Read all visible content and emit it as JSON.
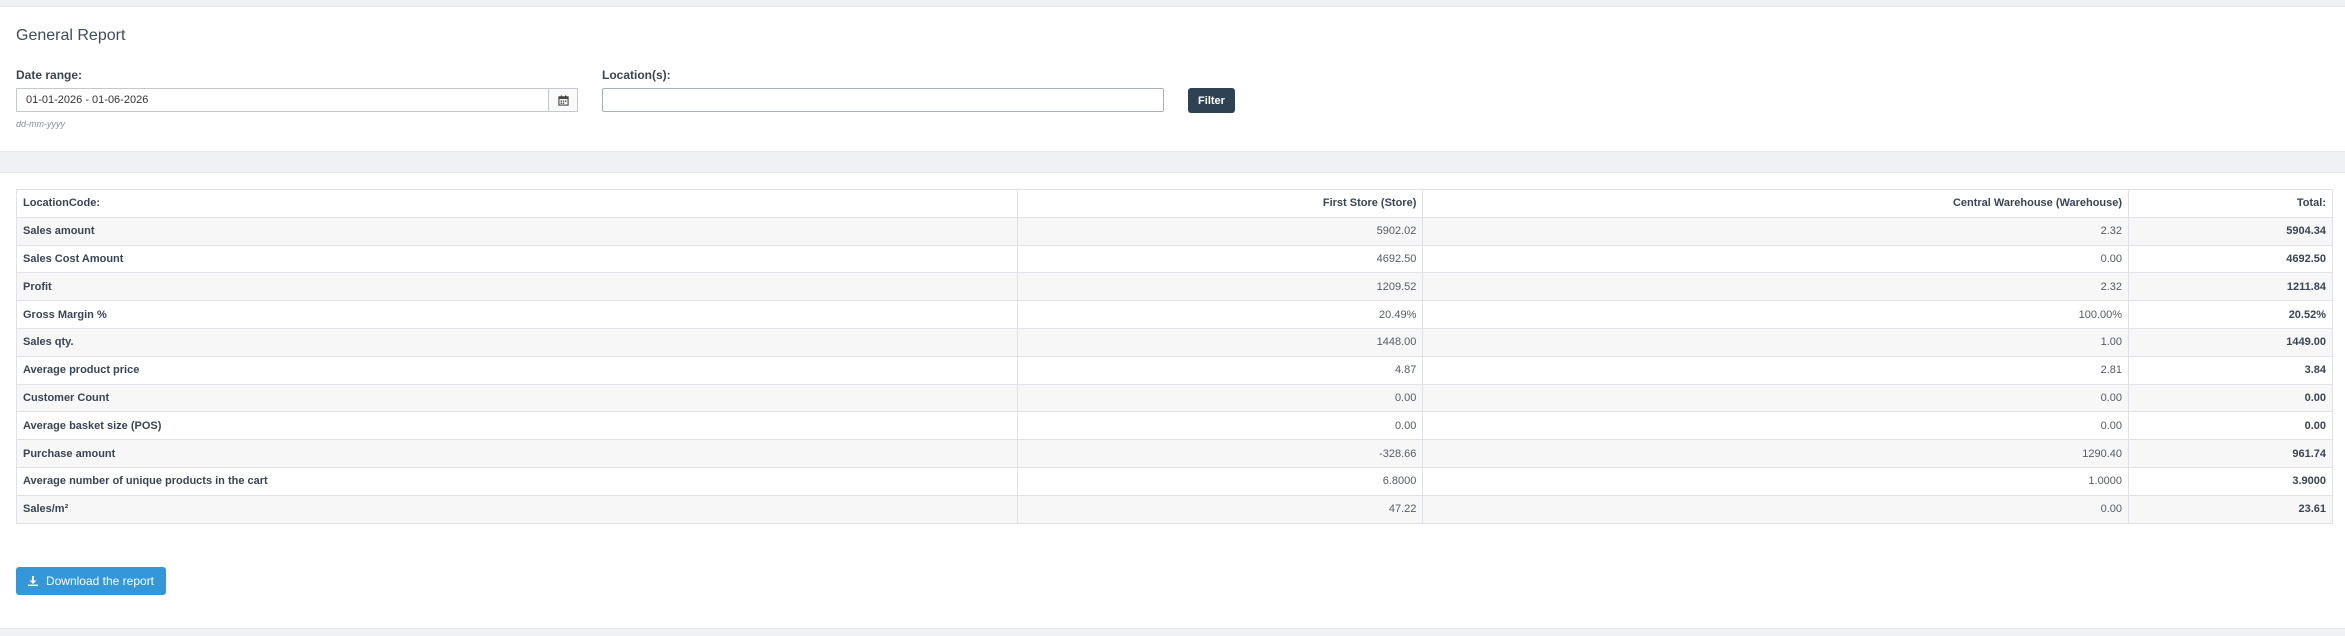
{
  "header": {
    "title": "General Report"
  },
  "filters": {
    "date_range_label": "Date range:",
    "date_range_value": "01-01-2026 - 01-06-2026",
    "date_format_hint": "dd-mm-yyyy",
    "location_label": "Location(s):",
    "location_value": "",
    "filter_button_label": "Filter"
  },
  "table": {
    "columns": [
      "LocationCode:",
      "First Store (Store)",
      "Central Warehouse (Warehouse)",
      "Total:"
    ],
    "rows": [
      [
        "Sales amount",
        "5902.02",
        "2.32",
        "5904.34"
      ],
      [
        "Sales Cost Amount",
        "4692.50",
        "0.00",
        "4692.50"
      ],
      [
        "Profit",
        "1209.52",
        "2.32",
        "1211.84"
      ],
      [
        "Gross Margin %",
        "20.49%",
        "100.00%",
        "20.52%"
      ],
      [
        "Sales qty.",
        "1448.00",
        "1.00",
        "1449.00"
      ],
      [
        "Average product price",
        "4.87",
        "2.81",
        "3.84"
      ],
      [
        "Customer Count",
        "0.00",
        "0.00",
        "0.00"
      ],
      [
        "Average basket size (POS)",
        "0.00",
        "0.00",
        "0.00"
      ],
      [
        "Purchase amount",
        "-328.66",
        "1290.40",
        "961.74"
      ],
      [
        "Average number of unique products in the cart",
        "6.8000",
        "1.0000",
        "3.9000"
      ],
      [
        "Sales/m²",
        "47.22",
        "0.00",
        "23.61"
      ]
    ]
  },
  "actions": {
    "download_label": "Download the report"
  },
  "icons": {
    "calendar": "calendar-icon",
    "download": "download-icon"
  },
  "colors": {
    "filter_button": "#2f4254",
    "download_button": "#3497da",
    "page_background": "#eff1f5"
  }
}
